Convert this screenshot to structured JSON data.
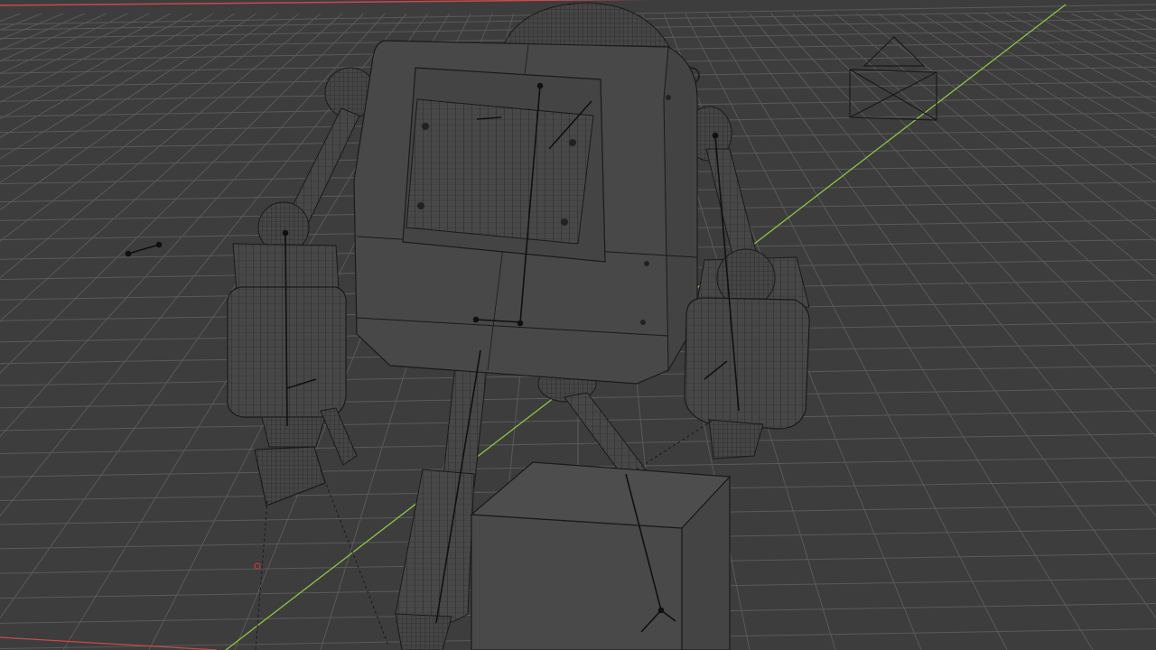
{
  "app": {
    "name": "3D viewport",
    "view_mode": "wireframe"
  },
  "colors": {
    "background": "#3d3d3d",
    "grid_line": "#5a5a5a",
    "x_axis": "#c84a4a",
    "y_axis": "#8cc63f",
    "wire": "#1e1e1e",
    "object_fill": "#4a4a4a",
    "object_fill_dark": "#444444",
    "bone": "#111111"
  },
  "scene": {
    "objects": [
      {
        "name": "robot-body",
        "type": "mesh"
      },
      {
        "name": "robot-head-dome",
        "type": "mesh"
      },
      {
        "name": "robot-left-arm",
        "type": "mesh"
      },
      {
        "name": "robot-right-arm",
        "type": "mesh"
      },
      {
        "name": "robot-left-leg",
        "type": "mesh"
      },
      {
        "name": "robot-right-leg",
        "type": "mesh"
      },
      {
        "name": "box",
        "type": "mesh"
      },
      {
        "name": "camera",
        "type": "camera"
      },
      {
        "name": "armature",
        "type": "armature"
      }
    ]
  }
}
